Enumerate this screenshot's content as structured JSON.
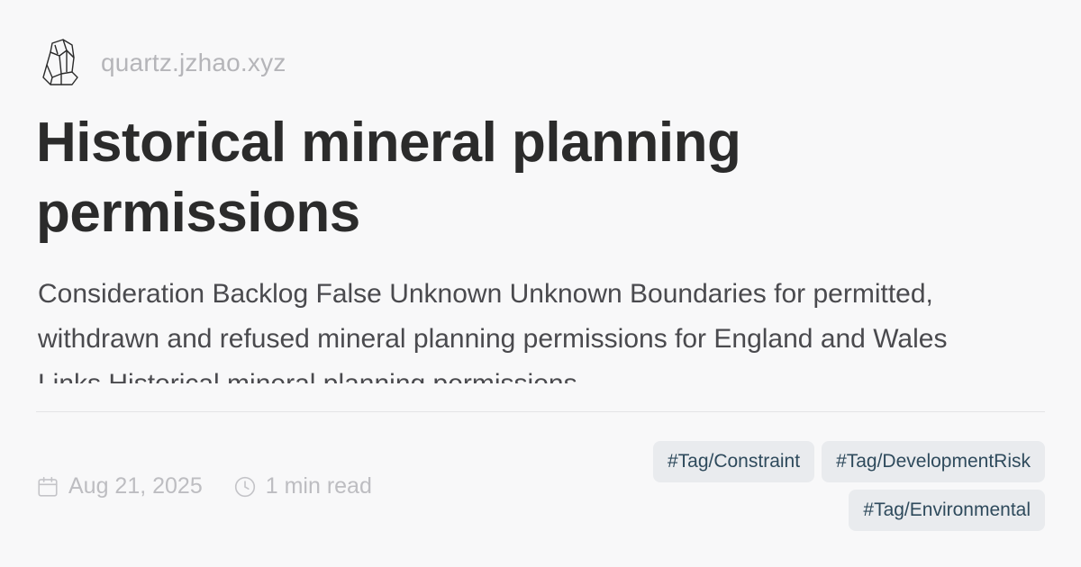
{
  "site": {
    "logo_icon": "crystal-logo-icon",
    "name": "quartz.jzhao.xyz"
  },
  "page": {
    "title": "Historical mineral planning permissions",
    "description": "Consideration Backlog False Unknown Unknown Boundaries for permitted, withdrawn and refused mineral planning permissions for England and Wales Links Historical mineral planning permissions"
  },
  "meta": {
    "date_icon": "calendar-icon",
    "date": "Aug 21, 2025",
    "reading_time_icon": "clock-icon",
    "reading_time": "1 min read"
  },
  "tags": [
    "#Tag/Constraint",
    "#Tag/DevelopmentRisk",
    "#Tag/Environmental"
  ],
  "colors": {
    "background": "#f8f8f9",
    "title": "#2b2b2b",
    "muted": "#b5b5b9",
    "tag_background": "#e9ebee",
    "tag_text": "#2e4a5c"
  }
}
